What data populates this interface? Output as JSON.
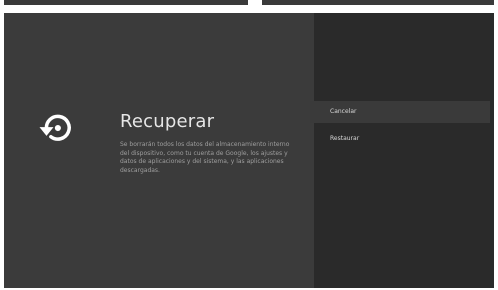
{
  "dialog": {
    "title": "Recuperar",
    "description": "Se borrarán todos los datos del almacenamiento interno del dispositivo, como tu cuenta de Google, los ajustes y datos de aplicaciones y del sistema, y las aplicaciones descargadas.",
    "icon": "restore-icon"
  },
  "options": [
    {
      "label": "Cancelar",
      "selected": true
    },
    {
      "label": "Restaurar",
      "selected": false
    }
  ],
  "colors": {
    "main_panel": "#3b3b3b",
    "side_panel": "#2a2a2a",
    "selected_option": "#3a3a3a",
    "text_primary": "#e6e6e6",
    "text_secondary": "#9e9e9e"
  }
}
